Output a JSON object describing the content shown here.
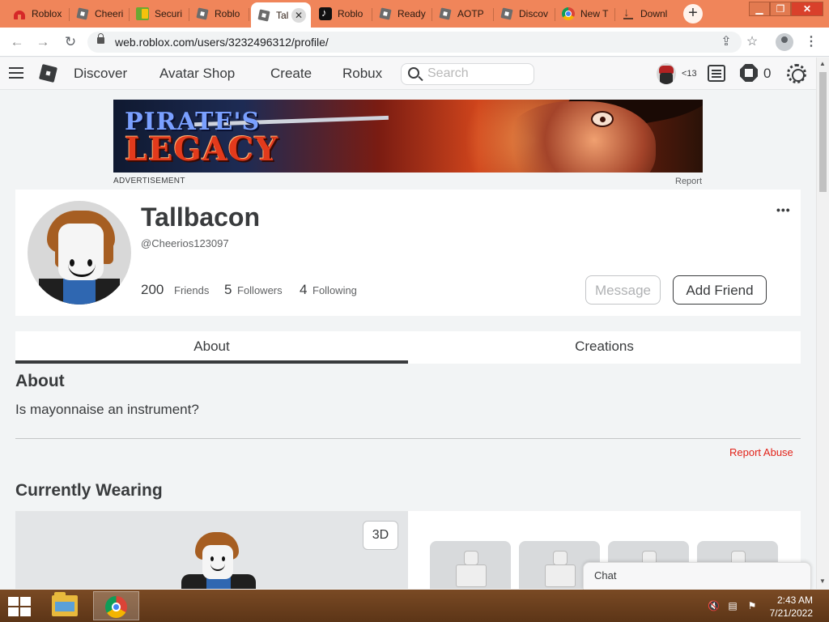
{
  "browser": {
    "tabs": [
      {
        "label": "Roblox",
        "icon": "house-icon"
      },
      {
        "label": "Cheeri",
        "icon": "roblox-icon"
      },
      {
        "label": "Securi",
        "icon": "green-icon"
      },
      {
        "label": "Roblo",
        "icon": "roblox-icon"
      },
      {
        "label": "Tal",
        "icon": "roblox-icon",
        "active": true
      },
      {
        "label": "Roblo",
        "icon": "tiktok-icon"
      },
      {
        "label": "Ready",
        "icon": "roblox-icon"
      },
      {
        "label": "AOTP",
        "icon": "roblox-icon"
      },
      {
        "label": "Discov",
        "icon": "roblox-icon"
      },
      {
        "label": "New T",
        "icon": "chrome-icon"
      },
      {
        "label": "Downl",
        "icon": "download-icon"
      }
    ],
    "new_tab_label": "+",
    "url": "web.roblox.com/users/3232496312/profile/",
    "accent_color": "#f0855a"
  },
  "nav": {
    "links": [
      "Discover",
      "Avatar Shop",
      "Create",
      "Robux"
    ],
    "search_placeholder": "Search",
    "age_label": "<13",
    "robux_count": "0"
  },
  "ad": {
    "title_line1": "PIRATE'S",
    "title_line2": "LEGACY",
    "label": "ADVERTISEMENT",
    "report": "Report"
  },
  "profile": {
    "display_name": "Tallbacon",
    "username": "@Cheerios123097",
    "friends_count": "200",
    "friends_label": "Friends",
    "followers_count": "5",
    "followers_label": "Followers",
    "following_count": "4",
    "following_label": "Following",
    "more_label": "•••",
    "message_button": "Message",
    "add_friend_button": "Add Friend"
  },
  "tabs": {
    "about": "About",
    "creations": "Creations"
  },
  "about": {
    "heading": "About",
    "text": "Is mayonnaise an instrument?",
    "report_abuse": "Report Abuse"
  },
  "wearing": {
    "heading": "Currently Wearing",
    "button_3d": "3D"
  },
  "chat": {
    "label": "Chat"
  },
  "taskbar": {
    "time": "2:43 AM",
    "date": "7/21/2022"
  }
}
